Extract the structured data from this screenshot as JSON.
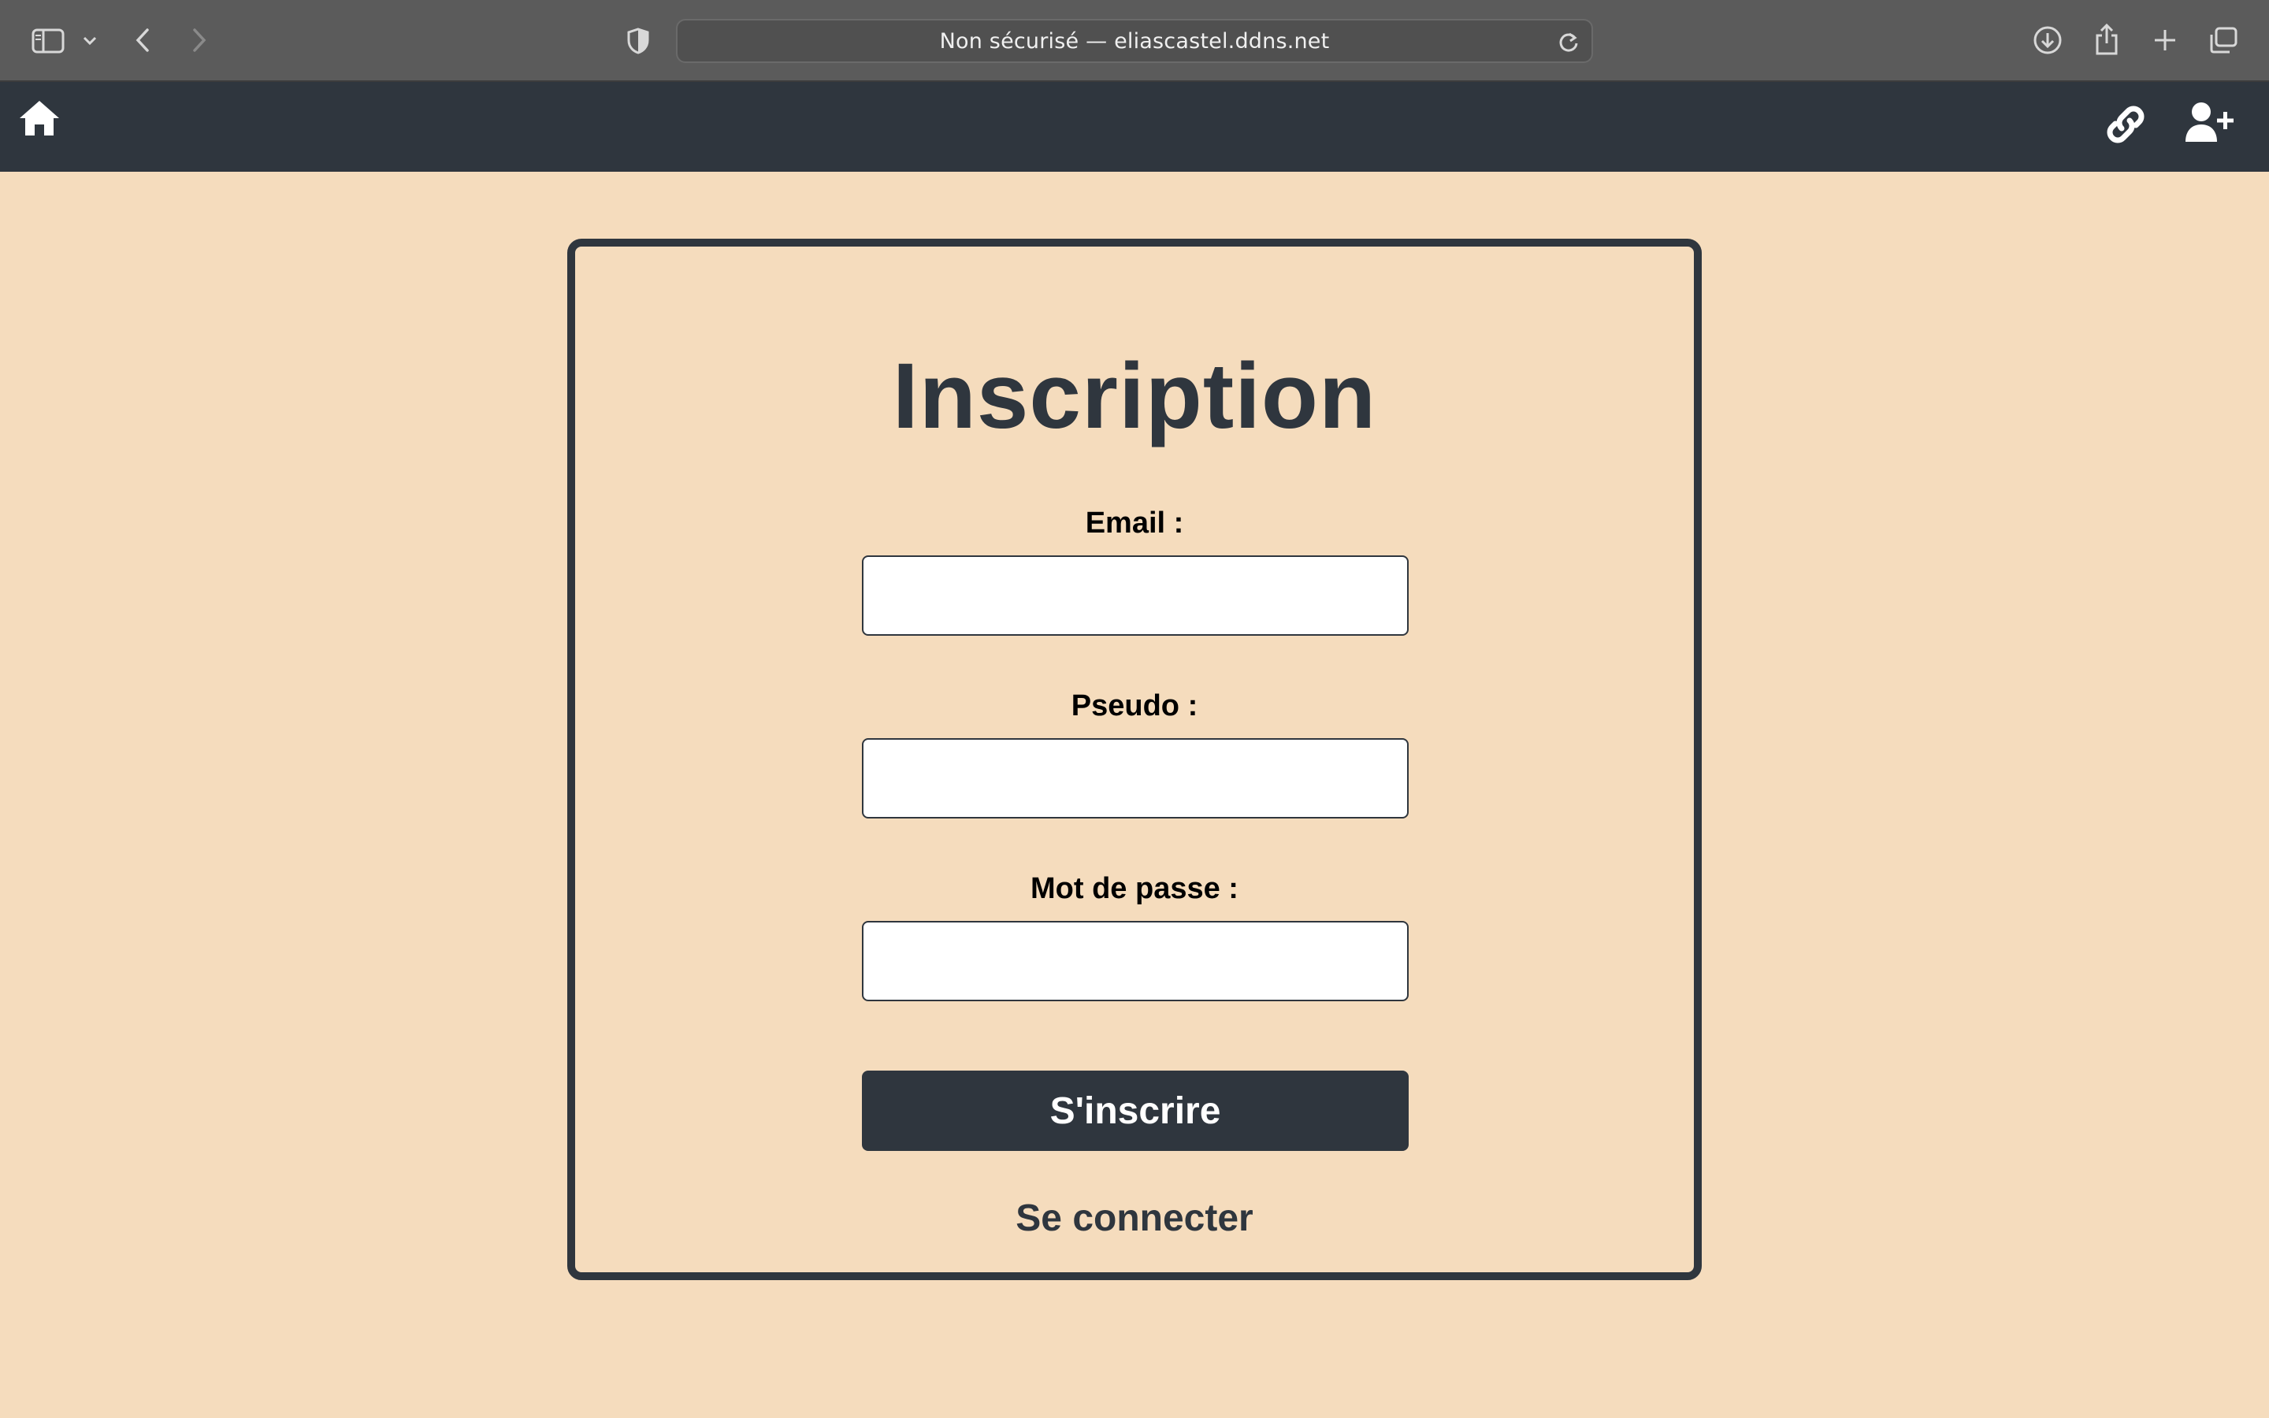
{
  "browser": {
    "url_display": "Non sécurisé — eliascastel.ddns.net",
    "icons": [
      "sidebar-icon",
      "chevron-down-icon",
      "back-icon",
      "forward-icon",
      "shield-icon",
      "reload-icon",
      "download-icon",
      "share-icon",
      "new-tab-icon",
      "tabs-overview-icon"
    ]
  },
  "nav": {
    "icons": [
      "home-icon",
      "link-icon",
      "user-plus-icon"
    ]
  },
  "form": {
    "title": "Inscription",
    "email_label": "Email :",
    "email_value": "",
    "pseudo_label": "Pseudo :",
    "pseudo_value": "",
    "password_label": "Mot de passe :",
    "password_value": "",
    "submit_label": "S'inscrire",
    "login_link": "Se connecter"
  },
  "colors": {
    "page_background": "#f5dcbd",
    "nav_background": "#2f363e",
    "accent": "#2f363e"
  }
}
